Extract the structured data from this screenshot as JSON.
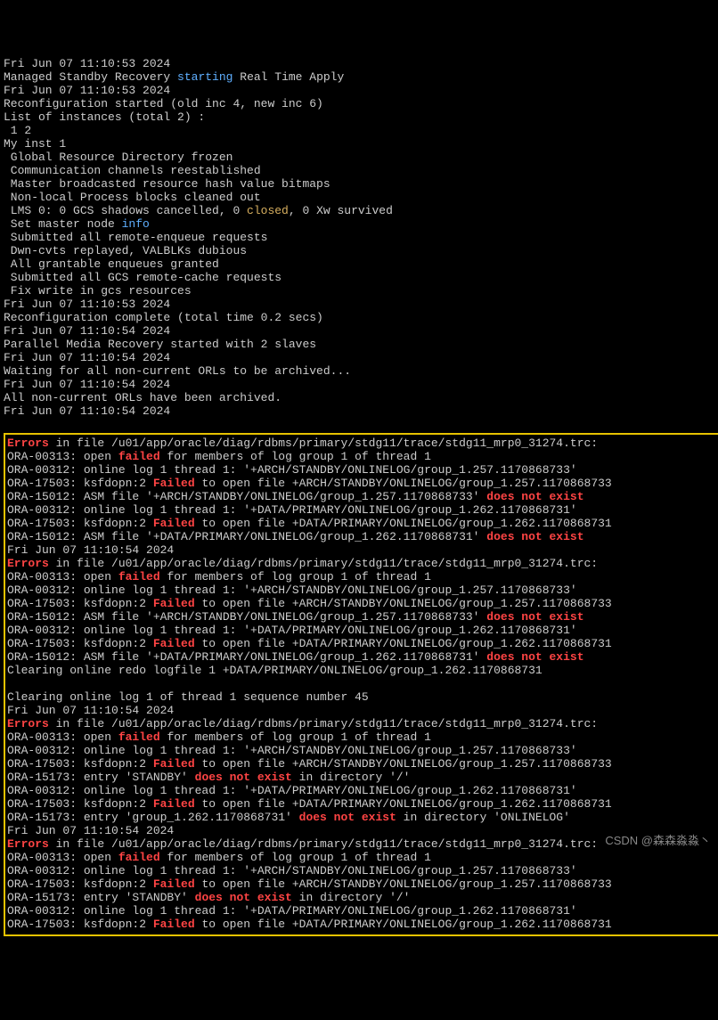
{
  "header": [
    {
      "segs": [
        {
          "t": "Fri Jun 07 11:10:53 2024"
        }
      ]
    },
    {
      "segs": [
        {
          "t": "Managed Standby Recovery "
        },
        {
          "t": "starting",
          "c": "kw-blue"
        },
        {
          "t": " Real Time Apply"
        }
      ]
    },
    {
      "segs": [
        {
          "t": "Fri Jun 07 11:10:53 2024"
        }
      ]
    },
    {
      "segs": [
        {
          "t": "Reconfiguration started (old inc 4, new inc 6)"
        }
      ]
    },
    {
      "segs": [
        {
          "t": "List of instances (total 2) :"
        }
      ]
    },
    {
      "segs": [
        {
          "t": " 1 2"
        }
      ]
    },
    {
      "segs": [
        {
          "t": "My inst 1"
        }
      ]
    },
    {
      "segs": [
        {
          "t": " Global Resource Directory frozen"
        }
      ]
    },
    {
      "segs": [
        {
          "t": " Communication channels reestablished"
        }
      ]
    },
    {
      "segs": [
        {
          "t": " Master broadcasted resource hash value bitmaps"
        }
      ]
    },
    {
      "segs": [
        {
          "t": " Non-local Process blocks cleaned out"
        }
      ]
    },
    {
      "segs": [
        {
          "t": " LMS 0: 0 GCS shadows cancelled, 0 "
        },
        {
          "t": "closed",
          "c": "kw-yellow"
        },
        {
          "t": ", 0 Xw survived"
        }
      ]
    },
    {
      "segs": [
        {
          "t": " Set master node "
        },
        {
          "t": "info",
          "c": "kw-blue"
        }
      ]
    },
    {
      "segs": [
        {
          "t": " Submitted all remote-enqueue requests"
        }
      ]
    },
    {
      "segs": [
        {
          "t": " Dwn-cvts replayed, VALBLKs dubious"
        }
      ]
    },
    {
      "segs": [
        {
          "t": " All grantable enqueues granted"
        }
      ]
    },
    {
      "segs": [
        {
          "t": " Submitted all GCS remote-cache requests"
        }
      ]
    },
    {
      "segs": [
        {
          "t": " Fix write in gcs resources"
        }
      ]
    },
    {
      "segs": [
        {
          "t": "Fri Jun 07 11:10:53 2024"
        }
      ]
    },
    {
      "segs": [
        {
          "t": "Reconfiguration complete (total time 0.2 secs)"
        }
      ]
    },
    {
      "segs": [
        {
          "t": "Fri Jun 07 11:10:54 2024"
        }
      ]
    },
    {
      "segs": [
        {
          "t": "Parallel Media Recovery started with 2 slaves"
        }
      ]
    },
    {
      "segs": [
        {
          "t": "Fri Jun 07 11:10:54 2024"
        }
      ]
    },
    {
      "segs": [
        {
          "t": "Waiting for all non-current ORLs to be archived..."
        }
      ]
    },
    {
      "segs": [
        {
          "t": "Fri Jun 07 11:10:54 2024"
        }
      ]
    },
    {
      "segs": [
        {
          "t": "All non-current ORLs have been archived."
        }
      ]
    },
    {
      "segs": [
        {
          "t": "Fri Jun 07 11:10:54 2024"
        }
      ]
    }
  ],
  "errors": [
    {
      "segs": [
        {
          "t": "Errors",
          "c": "kw-red"
        },
        {
          "t": " in file /u01/app/oracle/diag/rdbms/primary/stdg11/trace/stdg11_mrp0_31274.trc:"
        }
      ]
    },
    {
      "segs": [
        {
          "t": "ORA-00313: open "
        },
        {
          "t": "failed",
          "c": "kw-red"
        },
        {
          "t": " for members of log group 1 of thread 1"
        }
      ]
    },
    {
      "segs": [
        {
          "t": "ORA-00312: online log 1 thread 1: '+ARCH/STANDBY/ONLINELOG/group_1.257.1170868733'"
        }
      ]
    },
    {
      "segs": [
        {
          "t": "ORA-17503: ksfdopn:2 "
        },
        {
          "t": "Failed",
          "c": "kw-red"
        },
        {
          "t": " to open file +ARCH/STANDBY/ONLINELOG/group_1.257.1170868733"
        }
      ]
    },
    {
      "segs": [
        {
          "t": "ORA-15012: ASM file '+ARCH/STANDBY/ONLINELOG/group_1.257.1170868733' "
        },
        {
          "t": "does not exist",
          "c": "kw-red"
        }
      ]
    },
    {
      "segs": [
        {
          "t": "ORA-00312: online log 1 thread 1: '+DATA/PRIMARY/ONLINELOG/group_1.262.1170868731'"
        }
      ]
    },
    {
      "segs": [
        {
          "t": "ORA-17503: ksfdopn:2 "
        },
        {
          "t": "Failed",
          "c": "kw-red"
        },
        {
          "t": " to open file +DATA/PRIMARY/ONLINELOG/group_1.262.1170868731"
        }
      ]
    },
    {
      "segs": [
        {
          "t": "ORA-15012: ASM file '+DATA/PRIMARY/ONLINELOG/group_1.262.1170868731' "
        },
        {
          "t": "does not exist",
          "c": "kw-red"
        }
      ]
    },
    {
      "segs": [
        {
          "t": "Fri Jun 07 11:10:54 2024"
        }
      ]
    },
    {
      "segs": [
        {
          "t": "Errors",
          "c": "kw-red"
        },
        {
          "t": " in file /u01/app/oracle/diag/rdbms/primary/stdg11/trace/stdg11_mrp0_31274.trc:"
        }
      ]
    },
    {
      "segs": [
        {
          "t": "ORA-00313: open "
        },
        {
          "t": "failed",
          "c": "kw-red"
        },
        {
          "t": " for members of log group 1 of thread 1"
        }
      ]
    },
    {
      "segs": [
        {
          "t": "ORA-00312: online log 1 thread 1: '+ARCH/STANDBY/ONLINELOG/group_1.257.1170868733'"
        }
      ]
    },
    {
      "segs": [
        {
          "t": "ORA-17503: ksfdopn:2 "
        },
        {
          "t": "Failed",
          "c": "kw-red"
        },
        {
          "t": " to open file +ARCH/STANDBY/ONLINELOG/group_1.257.1170868733"
        }
      ]
    },
    {
      "segs": [
        {
          "t": "ORA-15012: ASM file '+ARCH/STANDBY/ONLINELOG/group_1.257.1170868733' "
        },
        {
          "t": "does not exist",
          "c": "kw-red"
        }
      ]
    },
    {
      "segs": [
        {
          "t": "ORA-00312: online log 1 thread 1: '+DATA/PRIMARY/ONLINELOG/group_1.262.1170868731'"
        }
      ]
    },
    {
      "segs": [
        {
          "t": "ORA-17503: ksfdopn:2 "
        },
        {
          "t": "Failed",
          "c": "kw-red"
        },
        {
          "t": " to open file +DATA/PRIMARY/ONLINELOG/group_1.262.1170868731"
        }
      ]
    },
    {
      "segs": [
        {
          "t": "ORA-15012: ASM file '+DATA/PRIMARY/ONLINELOG/group_1.262.1170868731' "
        },
        {
          "t": "does not exist",
          "c": "kw-red"
        }
      ]
    },
    {
      "segs": [
        {
          "t": "Clearing online redo logfile 1 +DATA/PRIMARY/ONLINELOG/group_1.262.1170868731"
        }
      ]
    },
    {
      "segs": [
        {
          "t": ""
        }
      ]
    },
    {
      "segs": [
        {
          "t": "Clearing online log 1 of thread 1 sequence number 45"
        }
      ]
    },
    {
      "segs": [
        {
          "t": "Fri Jun 07 11:10:54 2024"
        }
      ]
    },
    {
      "segs": [
        {
          "t": "Errors",
          "c": "kw-red"
        },
        {
          "t": " in file /u01/app/oracle/diag/rdbms/primary/stdg11/trace/stdg11_mrp0_31274.trc:"
        }
      ]
    },
    {
      "segs": [
        {
          "t": "ORA-00313: open "
        },
        {
          "t": "failed",
          "c": "kw-red"
        },
        {
          "t": " for members of log group 1 of thread 1"
        }
      ]
    },
    {
      "segs": [
        {
          "t": "ORA-00312: online log 1 thread 1: '+ARCH/STANDBY/ONLINELOG/group_1.257.1170868733'"
        }
      ]
    },
    {
      "segs": [
        {
          "t": "ORA-17503: ksfdopn:2 "
        },
        {
          "t": "Failed",
          "c": "kw-red"
        },
        {
          "t": " to open file +ARCH/STANDBY/ONLINELOG/group_1.257.1170868733"
        }
      ]
    },
    {
      "segs": [
        {
          "t": "ORA-15173: entry 'STANDBY' "
        },
        {
          "t": "does not exist",
          "c": "kw-red"
        },
        {
          "t": " in directory '/'"
        }
      ]
    },
    {
      "segs": [
        {
          "t": "ORA-00312: online log 1 thread 1: '+DATA/PRIMARY/ONLINELOG/group_1.262.1170868731'"
        }
      ]
    },
    {
      "segs": [
        {
          "t": "ORA-17503: ksfdopn:2 "
        },
        {
          "t": "Failed",
          "c": "kw-red"
        },
        {
          "t": " to open file +DATA/PRIMARY/ONLINELOG/group_1.262.1170868731"
        }
      ]
    },
    {
      "segs": [
        {
          "t": "ORA-15173: entry 'group_1.262.1170868731' "
        },
        {
          "t": "does not exist",
          "c": "kw-red"
        },
        {
          "t": " in directory 'ONLINELOG'"
        }
      ]
    },
    {
      "segs": [
        {
          "t": "Fri Jun 07 11:10:54 2024"
        }
      ]
    },
    {
      "segs": [
        {
          "t": "Errors",
          "c": "kw-red"
        },
        {
          "t": " in file /u01/app/oracle/diag/rdbms/primary/stdg11/trace/stdg11_mrp0_31274.trc:"
        }
      ]
    },
    {
      "segs": [
        {
          "t": "ORA-00313: open "
        },
        {
          "t": "failed",
          "c": "kw-red"
        },
        {
          "t": " for members of log group 1 of thread 1"
        }
      ]
    },
    {
      "segs": [
        {
          "t": "ORA-00312: online log 1 thread 1: '+ARCH/STANDBY/ONLINELOG/group_1.257.1170868733'"
        }
      ]
    },
    {
      "segs": [
        {
          "t": "ORA-17503: ksfdopn:2 "
        },
        {
          "t": "Failed",
          "c": "kw-red"
        },
        {
          "t": " to open file +ARCH/STANDBY/ONLINELOG/group_1.257.1170868733"
        }
      ]
    },
    {
      "segs": [
        {
          "t": "ORA-15173: entry 'STANDBY' "
        },
        {
          "t": "does not exist",
          "c": "kw-red"
        },
        {
          "t": " in directory '/'"
        }
      ]
    },
    {
      "segs": [
        {
          "t": "ORA-00312: online log 1 thread 1: '+DATA/PRIMARY/ONLINELOG/group_1.262.1170868731'"
        }
      ]
    },
    {
      "segs": [
        {
          "t": "ORA-17503: ksfdopn:2 "
        },
        {
          "t": "Failed",
          "c": "kw-red"
        },
        {
          "t": " to open file +DATA/PRIMARY/ONLINELOG/group_1.262.1170868731"
        }
      ]
    }
  ],
  "watermark": "CSDN @森森淼淼丶"
}
